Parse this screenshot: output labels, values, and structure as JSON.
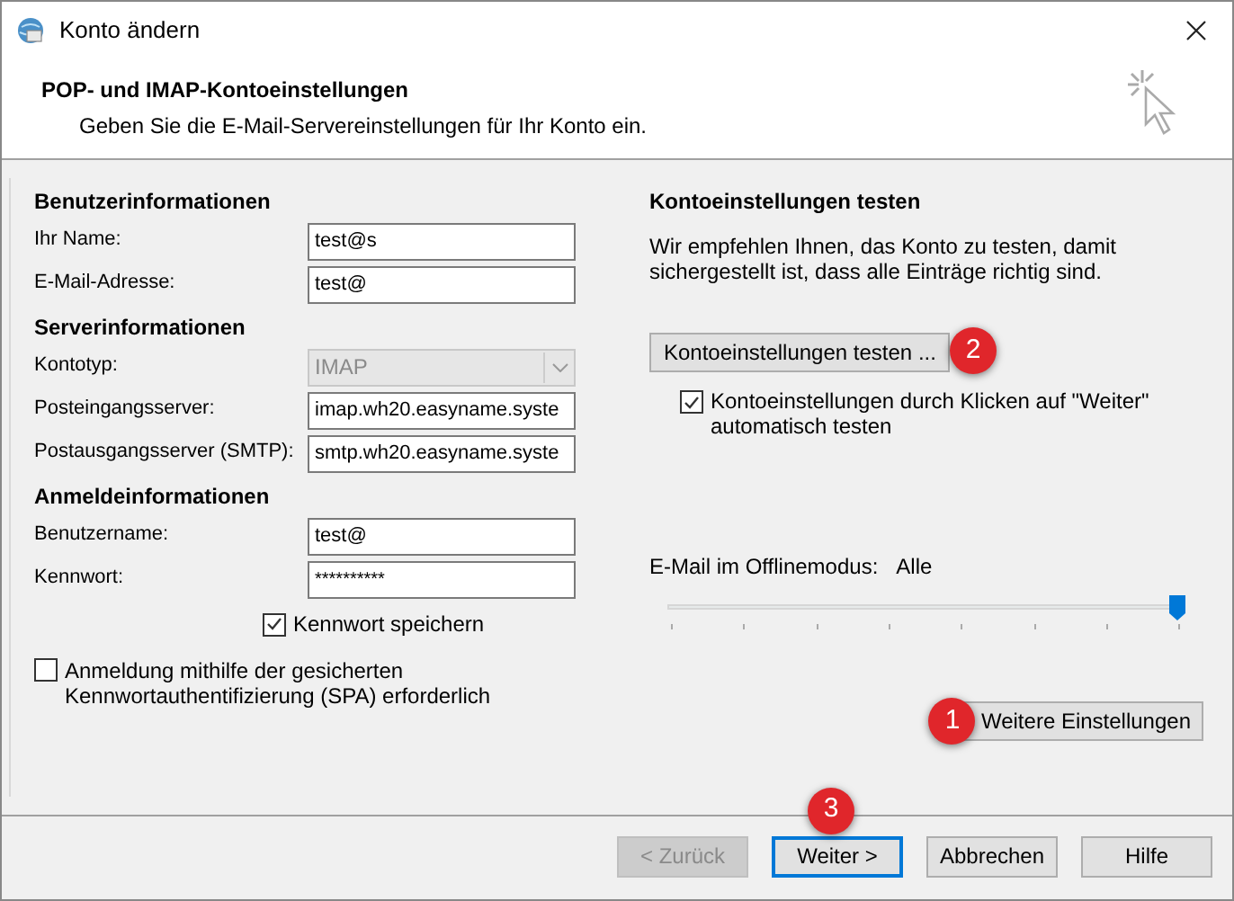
{
  "window": {
    "title": "Konto ändern"
  },
  "header": {
    "title": "POP- und IMAP-Kontoeinstellungen",
    "subtitle": "Geben Sie die E-Mail-Servereinstellungen für Ihr Konto ein."
  },
  "sections": [
    {
      "heading": "Benutzerinformationen",
      "fields": [
        {
          "kind": "text",
          "label": "Ihr Name:",
          "value": "test@s"
        },
        {
          "kind": "text",
          "label": "E-Mail-Adresse:",
          "value": "test@"
        }
      ]
    },
    {
      "heading": "Serverinformationen",
      "fields": [
        {
          "kind": "dropdown",
          "label": "Kontotyp:",
          "value": "IMAP",
          "disabled": true
        },
        {
          "kind": "text",
          "label": "Posteingangsserver:",
          "value": "imap.wh20.easyname.syste"
        },
        {
          "kind": "text",
          "label": "Postausgangsserver (SMTP):",
          "value": "smtp.wh20.easyname.syste"
        }
      ]
    },
    {
      "heading": "Anmeldeinformationen",
      "fields": [
        {
          "kind": "text",
          "label": "Benutzername:",
          "value": "test@"
        },
        {
          "kind": "password",
          "label": "Kennwort:",
          "value": "**********"
        }
      ]
    }
  ],
  "save_password": {
    "label": "Kennwort speichern",
    "checked": true
  },
  "spa": {
    "label": "Anmeldung mithilfe der gesicherten Kennwortauthentifizierung (SPA) erforderlich",
    "checked": false
  },
  "test": {
    "heading": "Kontoeinstellungen testen",
    "description": "Wir empfehlen Ihnen, das Konto zu testen, damit sichergestellt ist, dass alle Einträge richtig sind.",
    "button": {
      "label": "Kontoeinstellungen testen ...",
      "badge": "2"
    },
    "auto_test": {
      "label": "Kontoeinstellungen durch Klicken auf \"Weiter\" automatisch testen",
      "checked": true
    }
  },
  "offline": {
    "label": "E-Mail im Offlinemodus:",
    "value": "Alle",
    "level": 1
  },
  "more_settings": {
    "label": "Weitere Einstellungen",
    "badge": "1"
  },
  "footer_buttons": [
    {
      "label": "< Zurück",
      "disabled": true,
      "default": false
    },
    {
      "label": "Weiter >",
      "disabled": false,
      "default": true,
      "badge": "3"
    },
    {
      "label": "Abbrechen",
      "disabled": false,
      "default": false
    },
    {
      "label": "Hilfe",
      "disabled": false,
      "default": false
    }
  ]
}
